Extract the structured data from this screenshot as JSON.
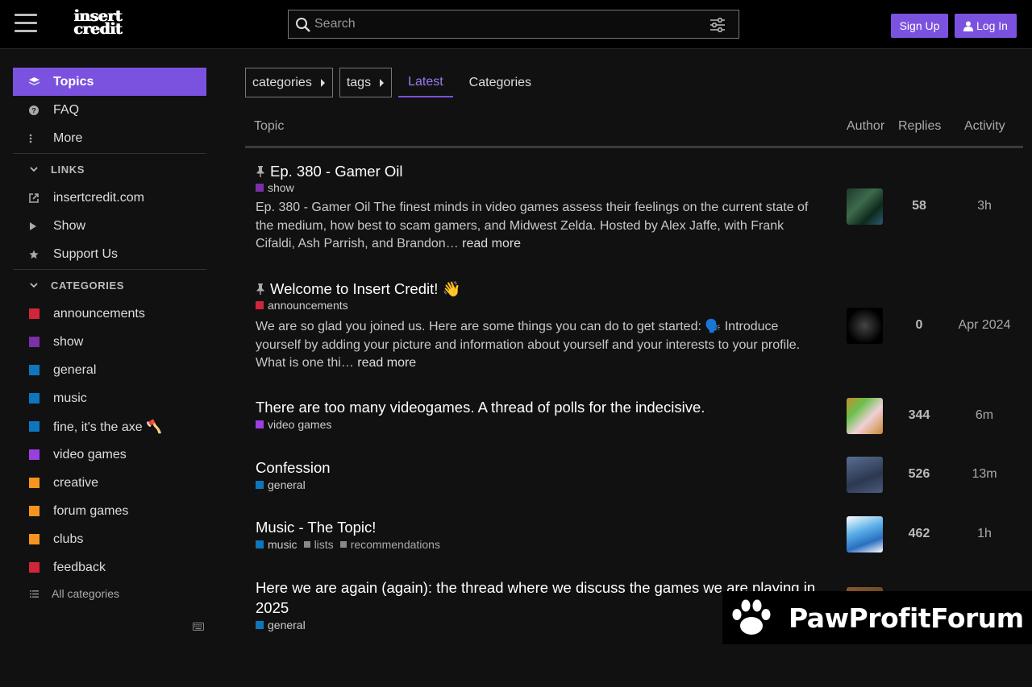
{
  "header": {
    "logo_line1": "insert",
    "logo_line2": "credit",
    "search_placeholder": "Search",
    "signup_label": "Sign Up",
    "login_label": "Log In"
  },
  "sidebar": {
    "main_items": [
      {
        "label": "Topics",
        "icon": "layers-icon"
      },
      {
        "label": "FAQ",
        "icon": "question-circle-icon"
      },
      {
        "label": "More",
        "icon": "ellipsis-vertical-icon"
      }
    ],
    "links_header": "LINKS",
    "links": [
      {
        "label": "insertcredit.com",
        "icon": "external-link-icon"
      },
      {
        "label": "Show",
        "icon": "play-icon"
      },
      {
        "label": "Support Us",
        "icon": "star-icon"
      }
    ],
    "categories_header": "CATEGORIES",
    "categories": [
      {
        "label": "announcements",
        "color": "#d1253b"
      },
      {
        "label": "show",
        "color": "#7b2fa8"
      },
      {
        "label": "general",
        "color": "#0e76bd"
      },
      {
        "label": "music",
        "color": "#0e76bd"
      },
      {
        "label": "fine, it's the axe 🪓",
        "color": "#0e76bd"
      },
      {
        "label": "video games",
        "color": "#9a3fe0"
      },
      {
        "label": "creative",
        "color": "#f7941d"
      },
      {
        "label": "forum games",
        "color": "#f7941d"
      },
      {
        "label": "clubs",
        "color": "#f7941d"
      },
      {
        "label": "feedback",
        "color": "#d1253b"
      }
    ],
    "all_categories": "All categories"
  },
  "nav": {
    "categories_dd": "categories",
    "tags_dd": "tags",
    "tabs": [
      "Latest",
      "Categories"
    ]
  },
  "table": {
    "headers": {
      "topic": "Topic",
      "author": "Author",
      "replies": "Replies",
      "activity": "Activity"
    },
    "rows": [
      {
        "title": "Ep. 380 - Gamer Oil",
        "pinned": true,
        "categories": [
          {
            "label": "show",
            "color": "#7b2fa8"
          }
        ],
        "excerpt": "Ep. 380 - Gamer Oil The finest minds in video games assess their feelings on the current state of the medium, how best to scam gamers, and Midwest Zelda. Hosted by Alex Jaffe, with Frank Cifaldi, Ash Parrish, and Brandon…",
        "read_more": "read more",
        "replies": "58",
        "activity": "3h"
      },
      {
        "title": "Welcome to Insert Credit! 👋",
        "pinned": true,
        "categories": [
          {
            "label": "announcements",
            "color": "#d1253b"
          }
        ],
        "excerpt": "We are so glad you joined us. Here are some things you can do to get started: 🗣️ Introduce yourself by adding your picture and information about yourself and your interests to your profile. What is one thi…",
        "read_more": "read more",
        "replies": "0",
        "activity": "Apr 2024"
      },
      {
        "title": "There are too many videogames. A thread of polls for the indecisive.",
        "pinned": false,
        "categories": [
          {
            "label": "video games",
            "color": "#9a3fe0"
          }
        ],
        "replies": "344",
        "activity": "6m"
      },
      {
        "title": "Confession",
        "pinned": false,
        "categories": [
          {
            "label": "general",
            "color": "#0e76bd"
          }
        ],
        "replies": "526",
        "activity": "13m"
      },
      {
        "title": "Music - The Topic!",
        "pinned": false,
        "categories": [
          {
            "label": "music",
            "color": "#0e76bd"
          }
        ],
        "tags": [
          "lists",
          "recommendations"
        ],
        "replies": "462",
        "activity": "1h"
      },
      {
        "title": "Here we are again (again): the thread where we discuss the games we are playing in 2025",
        "pinned": false,
        "categories": [
          {
            "label": "general",
            "color": "#0e76bd"
          }
        ]
      }
    ]
  },
  "watermark": "PawProfitForum"
}
